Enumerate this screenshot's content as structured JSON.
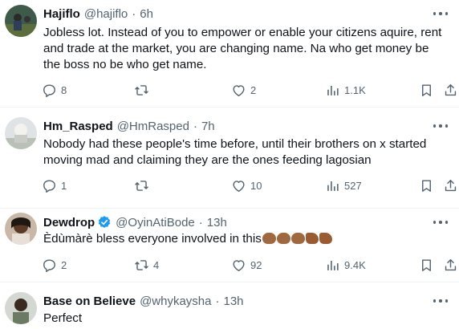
{
  "tweets": [
    {
      "name": "Hajiflo",
      "handle": "@hajiflo",
      "sep": "·",
      "time": "6h",
      "text": "Jobless lot. Instead of you to empower or enable your citizens aquire, rent and trade at the market, you are changing name. Na who get money be the boss no be who get name.",
      "replies": "8",
      "reposts": "",
      "likes": "2",
      "views": "1.1K"
    },
    {
      "name": "Hm_Rasped",
      "handle": "@HmRasped",
      "sep": "·",
      "time": "7h",
      "text": "Nobody had these people's time before, until their brothers on x started moving mad and claiming they are the ones feeding lagosian",
      "replies": "1",
      "reposts": "",
      "likes": "10",
      "views": "527"
    },
    {
      "name": "Dewdrop",
      "handle": "@OyinAtiBode",
      "sep": "·",
      "time": "13h",
      "verified": true,
      "text": "Èdùmàrè bless everyone involved in this",
      "emojis": [
        "clapping-hands",
        "clapping-hands",
        "clapping-hands",
        "flexed-biceps",
        "flexed-biceps"
      ],
      "replies": "2",
      "reposts": "4",
      "likes": "92",
      "views": "9.4K"
    },
    {
      "name": "Base on Believe",
      "handle": "@whykaysha",
      "sep": "·",
      "time": "13h",
      "text": "Perfect"
    }
  ],
  "icons": {
    "reply": "reply-icon",
    "repost": "repost-icon",
    "like": "like-icon",
    "views": "views-icon",
    "bookmark": "bookmark-icon",
    "share": "share-icon",
    "more": "more-icon"
  },
  "colors": {
    "text": "#0f1419",
    "secondary": "#536471",
    "verified": "#1d9bf0",
    "divider": "#eff3f4"
  }
}
